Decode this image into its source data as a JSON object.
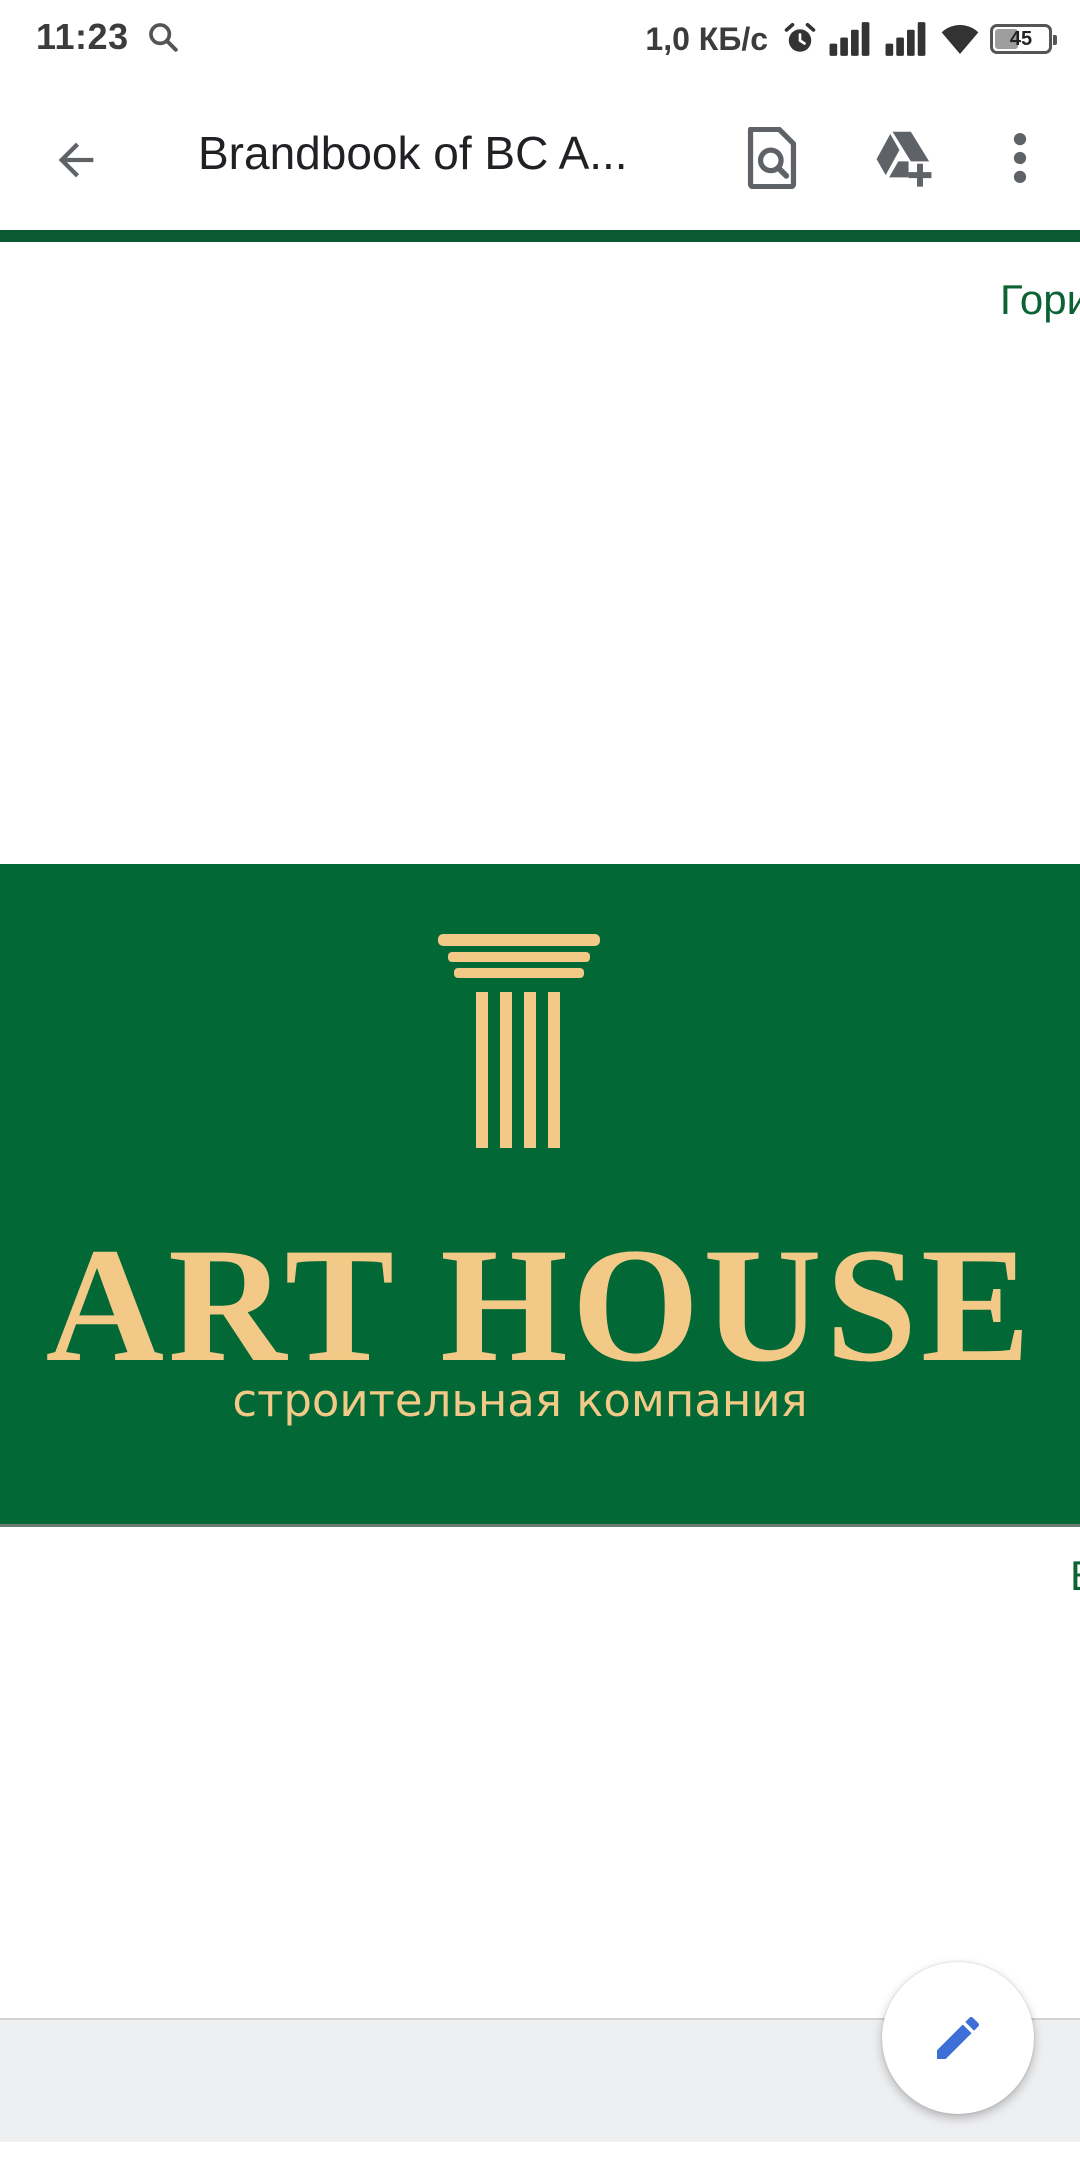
{
  "status_bar": {
    "time": "11:23",
    "net_speed": "1,0 КБ/с",
    "battery_level": "45",
    "icons": [
      "search-icon",
      "alarm-icon",
      "signal-icon",
      "signal-icon",
      "wifi-icon",
      "battery-icon"
    ]
  },
  "toolbar": {
    "title": "Brandbook of BC A...",
    "icons": [
      "back-arrow-icon",
      "find-in-page-icon",
      "drive-add-icon",
      "more-vert-icon"
    ]
  },
  "document": {
    "top_cut_text": "Гори",
    "bottom_cut_text": "В",
    "brand_name": "ART HOUSE",
    "tagline": "строительная компания",
    "colors": {
      "banner": "#016836",
      "gold": "#f3c987",
      "accent_rule": "#0b5a34"
    }
  },
  "fab": {
    "icon": "edit-pencil-icon"
  }
}
